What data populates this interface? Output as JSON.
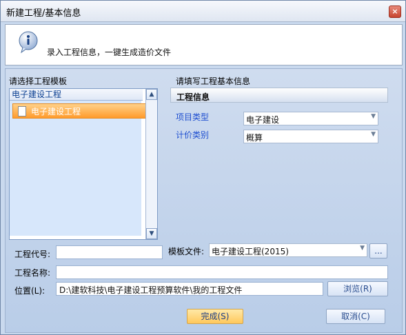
{
  "window": {
    "title": "新建工程/基本信息",
    "close_label": "×"
  },
  "banner": {
    "message": "录入工程信息，一键生成造价文件"
  },
  "template_panel": {
    "heading": "请选择工程模板",
    "list_header": "电子建设工程",
    "items": [
      {
        "label": "电子建设工程",
        "selected": true
      }
    ]
  },
  "project_info": {
    "heading": "请填写工程基本信息",
    "section_title": "工程信息",
    "fields": [
      {
        "label": "项目类型",
        "value": "电子建设"
      },
      {
        "label": "计价类别",
        "value": "概算"
      }
    ]
  },
  "form": {
    "code_label": "工程代号:",
    "code_value": "",
    "template_file_label": "模板文件:",
    "template_file_value": "电子建设工程(2015)",
    "template_browse_label": "...",
    "name_label": "工程名称:",
    "name_value": "",
    "location_label": "位置(L):",
    "location_value": "D:\\建软科技\\电子建设工程预算软件\\我的工程文件",
    "browse_label": "浏览(R)"
  },
  "buttons": {
    "finish": "完成(S)",
    "cancel": "取消(C)"
  },
  "colors": {
    "selection": "#ff9b2c",
    "accent": "#1f4fd0"
  }
}
